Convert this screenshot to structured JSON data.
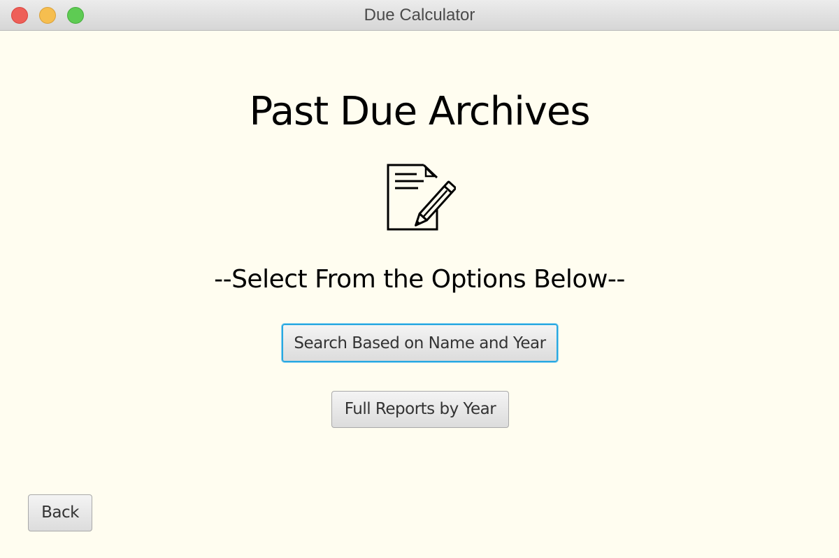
{
  "window": {
    "title": "Due Calculator"
  },
  "main": {
    "title": "Past Due Archives",
    "icon": "document-edit-icon",
    "subtitle": "--Select From the Options Below--",
    "buttons": {
      "search_label": "Search Based on Name and Year",
      "reports_label": "Full Reports by Year"
    }
  },
  "footer": {
    "back_label": "Back"
  },
  "colors": {
    "background": "#fffdf0",
    "focus_ring": "#28a8e0",
    "close": "#ee5f58",
    "minimize": "#f6be4f",
    "maximize": "#5ecb53"
  }
}
